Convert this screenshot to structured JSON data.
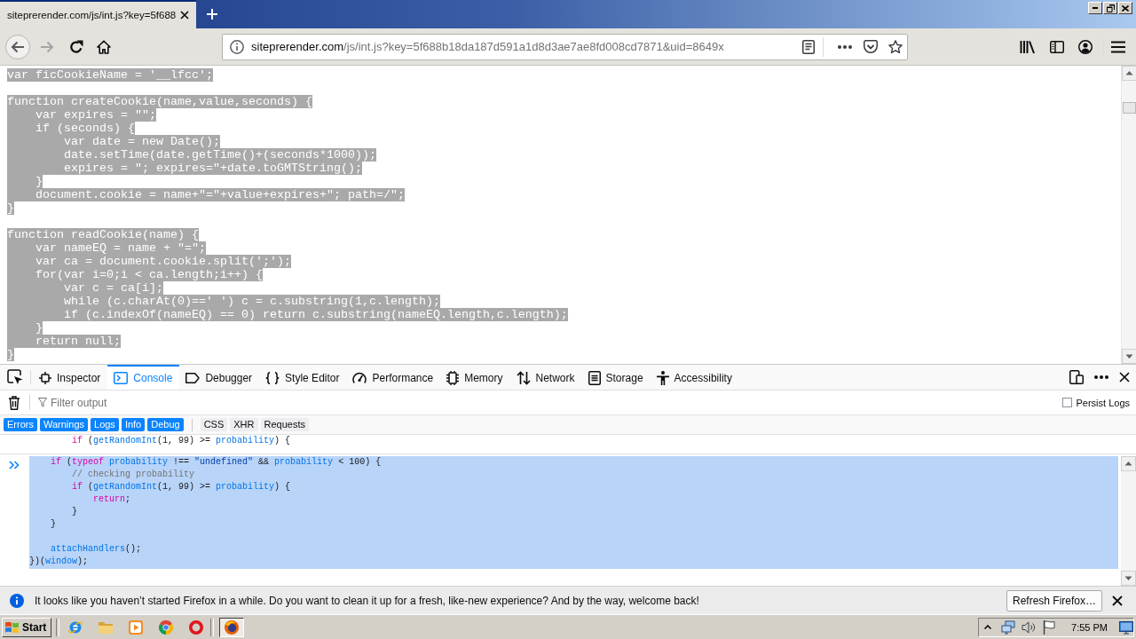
{
  "browser_tab": {
    "title": "siteprerender.com/js/int.js?key=5f688",
    "selected": true
  },
  "navigation": {
    "back": {
      "disabled": false
    },
    "forward": {
      "disabled": true
    }
  },
  "address_bar": {
    "host": "siteprerender.com",
    "path": "/js/int.js?key=5f688b18da187d591a1d8d3ae7ae8fd008cd7871&uid=8649x"
  },
  "page_source": {
    "selected": true,
    "blocks": [
      [
        "var ficCookieName = '__lfcc';"
      ],
      [
        "function createCookie(name,value,seconds) {",
        "    var expires = \"\";",
        "    if (seconds) {",
        "        var date = new Date();",
        "        date.setTime(date.getTime()+(seconds*1000));",
        "        expires = \"; expires=\"+date.toGMTString();",
        "    }",
        "    document.cookie = name+\"=\"+value+expires+\"; path=/\";",
        "}"
      ],
      [
        "function readCookie(name) {",
        "    var nameEQ = name + \"=\";",
        "    var ca = document.cookie.split(';');",
        "    for(var i=0;i < ca.length;i++) {",
        "        var c = ca[i];",
        "        while (c.charAt(0)==' ') c = c.substring(1,c.length);",
        "        if (c.indexOf(nameEQ) == 0) return c.substring(nameEQ.length,c.length);",
        "    }",
        "    return null;",
        "}"
      ]
    ]
  },
  "devtools": {
    "tabs": [
      {
        "label": "Inspector",
        "selected": false
      },
      {
        "label": "Console",
        "selected": true
      },
      {
        "label": "Debugger",
        "selected": false
      },
      {
        "label": "Style Editor",
        "selected": false
      },
      {
        "label": "Performance",
        "selected": false
      },
      {
        "label": "Memory",
        "selected": false
      },
      {
        "label": "Network",
        "selected": false
      },
      {
        "label": "Storage",
        "selected": false
      },
      {
        "label": "Accessibility",
        "selected": false
      }
    ],
    "filter": {
      "placeholder": "Filter output"
    },
    "persist_logs": {
      "label": "Persist Logs",
      "checked": false
    },
    "log_levels": [
      {
        "label": "Errors",
        "selected": true
      },
      {
        "label": "Warnings",
        "selected": true
      },
      {
        "label": "Logs",
        "selected": true
      },
      {
        "label": "Info",
        "selected": true
      },
      {
        "label": "Debug",
        "selected": true
      }
    ],
    "request_types": [
      {
        "label": "CSS",
        "selected": false
      },
      {
        "label": "XHR",
        "selected": false
      },
      {
        "label": "Requests",
        "selected": false
      }
    ],
    "output": {
      "previous_message": [
        {
          "kind": "keyword",
          "text": "        if"
        },
        {
          "kind": "plain",
          "text": " ("
        },
        {
          "kind": "identifier",
          "text": "getRandomInt"
        },
        {
          "kind": "plain",
          "text": "(1, 99) >= "
        },
        {
          "kind": "identifier",
          "text": "probability"
        },
        {
          "kind": "plain",
          "text": ") {"
        }
      ],
      "input": {
        "selected": true,
        "blocks": [
          [
            [
              {
                "kind": "keyword",
                "text": "    if"
              },
              {
                "kind": "plain",
                "text": " ("
              },
              {
                "kind": "keyword",
                "text": "typeof"
              },
              {
                "kind": "identifier",
                "text": " probability"
              },
              {
                "kind": "plain",
                "text": " !== "
              },
              {
                "kind": "string",
                "text": "\"undefined\""
              },
              {
                "kind": "plain",
                "text": " && "
              },
              {
                "kind": "identifier",
                "text": "probability"
              },
              {
                "kind": "plain",
                "text": " < 100) {"
              }
            ],
            [
              {
                "kind": "comment",
                "text": "        // checking probability"
              }
            ],
            [
              {
                "kind": "keyword",
                "text": "        if"
              },
              {
                "kind": "plain",
                "text": " ("
              },
              {
                "kind": "identifier",
                "text": "getRandomInt"
              },
              {
                "kind": "plain",
                "text": "(1, 99) >= "
              },
              {
                "kind": "identifier",
                "text": "probability"
              },
              {
                "kind": "plain",
                "text": ") {"
              }
            ],
            [
              {
                "kind": "keyword",
                "text": "            return"
              },
              {
                "kind": "plain",
                "text": ";"
              }
            ],
            [
              {
                "kind": "plain",
                "text": "        }"
              }
            ],
            [
              {
                "kind": "plain",
                "text": "    }"
              }
            ]
          ],
          [
            [
              {
                "kind": "identifier",
                "text": "    attachHandlers"
              },
              {
                "kind": "plain",
                "text": "();"
              }
            ],
            [
              {
                "kind": "plain",
                "text": "})("
              },
              {
                "kind": "identifier",
                "text": "window"
              },
              {
                "kind": "plain",
                "text": ");"
              }
            ]
          ]
        ]
      }
    }
  },
  "notification": {
    "message": "It looks like you haven’t started Firefox in a while. Do you want to clean it up for a fresh, like-new experience? And by the way, welcome back!",
    "button": "Refresh Firefox…"
  },
  "taskbar": {
    "start": "Start",
    "task_buttons": [
      {
        "selected": true
      }
    ],
    "clock": "7:55 PM"
  }
}
